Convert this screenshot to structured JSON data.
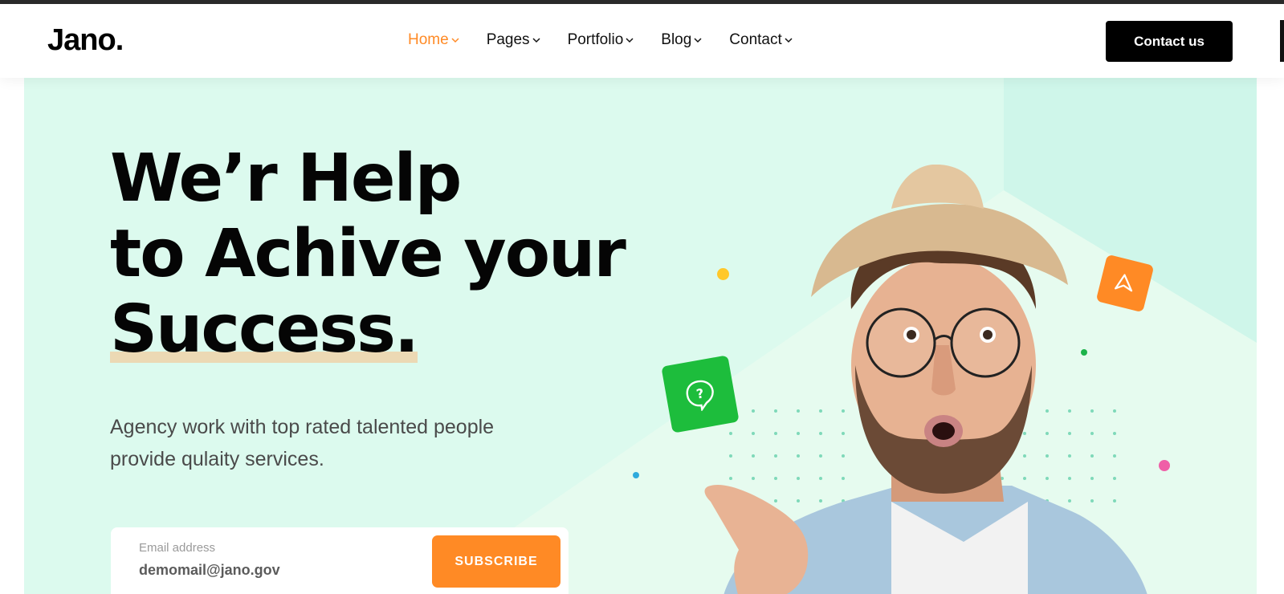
{
  "brand": {
    "logo": "Jano.",
    "accent": "#ff8a25",
    "dark": "#000000",
    "hero_bg": "#dcfaee"
  },
  "nav": {
    "items": [
      {
        "label": "Home",
        "active": true
      },
      {
        "label": "Pages",
        "active": false
      },
      {
        "label": "Portfolio",
        "active": false
      },
      {
        "label": "Blog",
        "active": false
      },
      {
        "label": "Contact",
        "active": false
      }
    ]
  },
  "header": {
    "cta_label": "Contact us"
  },
  "hero": {
    "headline_line1": "We’r Help",
    "headline_line2": "to Achive your",
    "headline_line3": "Success.",
    "subtext_line1": "Agency work with top rated talented people",
    "subtext_line2": "provide qulaity services."
  },
  "subscribe_form": {
    "label": "Email address",
    "value": "demomail@jano.gov",
    "button_label": "SUBSCRIBE"
  },
  "decor": {
    "icons": [
      "question-chat-icon",
      "paper-plane-icon"
    ],
    "colors": {
      "green_tile": "#1dbd3c",
      "orange_tile": "#ff8a25",
      "yellow_dot": "#ffc82a",
      "pink_dot": "#ef5fa7",
      "blue_dot": "#2eaadc",
      "green_dot": "#1cb34a"
    }
  }
}
